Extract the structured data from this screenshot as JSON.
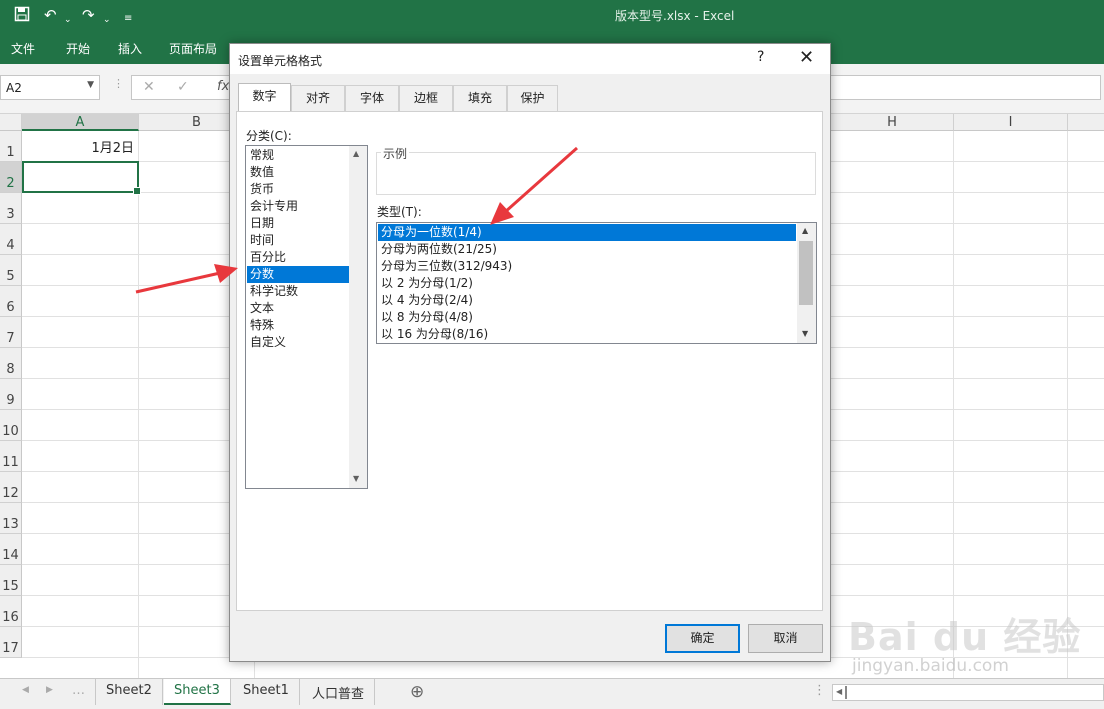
{
  "window": {
    "title": "版本型号.xlsx  -  Excel"
  },
  "quick_access": {
    "save_icon": "save-icon",
    "undo_icon": "undo-icon",
    "redo_icon": "redo-icon"
  },
  "ribbon": {
    "tabs": [
      "文件",
      "开始",
      "插入",
      "页面布局"
    ]
  },
  "formula_bar": {
    "name_box": "A2",
    "fx": "fx"
  },
  "grid": {
    "columns": [
      "A",
      "B",
      "H",
      "I"
    ],
    "rows": [
      "1",
      "2",
      "3",
      "4",
      "5",
      "6",
      "7",
      "8",
      "9",
      "10",
      "11",
      "12",
      "13",
      "14",
      "15",
      "16",
      "17"
    ],
    "cell_a1": "1月2日"
  },
  "sheets": {
    "tabs": [
      "Sheet2",
      "Sheet3",
      "Sheet1",
      "人口普查"
    ],
    "active": "Sheet3",
    "add": "⊕"
  },
  "dialog": {
    "title": "设置单元格格式",
    "help": "?",
    "close": "✕",
    "tabs": [
      "数字",
      "对齐",
      "字体",
      "边框",
      "填充",
      "保护"
    ],
    "category_label": "分类(C):",
    "categories": [
      "常规",
      "数值",
      "货币",
      "会计专用",
      "日期",
      "时间",
      "百分比",
      "分数",
      "科学记数",
      "文本",
      "特殊",
      "自定义"
    ],
    "selected_category": "分数",
    "sample_label": "示例",
    "type_label": "类型(T):",
    "types": [
      "分母为一位数(1/4)",
      "分母为两位数(21/25)",
      "分母为三位数(312/943)",
      "以 2 为分母(1/2)",
      "以 4 为分母(2/4)",
      "以 8 为分母(4/8)",
      "以 16 为分母(8/16)"
    ],
    "selected_type": "分母为一位数(1/4)",
    "ok": "确定",
    "cancel": "取消"
  },
  "watermark": {
    "brand": "Bai du 经验",
    "url": "jingyan.baidu.com"
  },
  "colors": {
    "excel_green": "#217346",
    "selection_blue": "#0078d7",
    "arrow_red": "#e8383d"
  }
}
